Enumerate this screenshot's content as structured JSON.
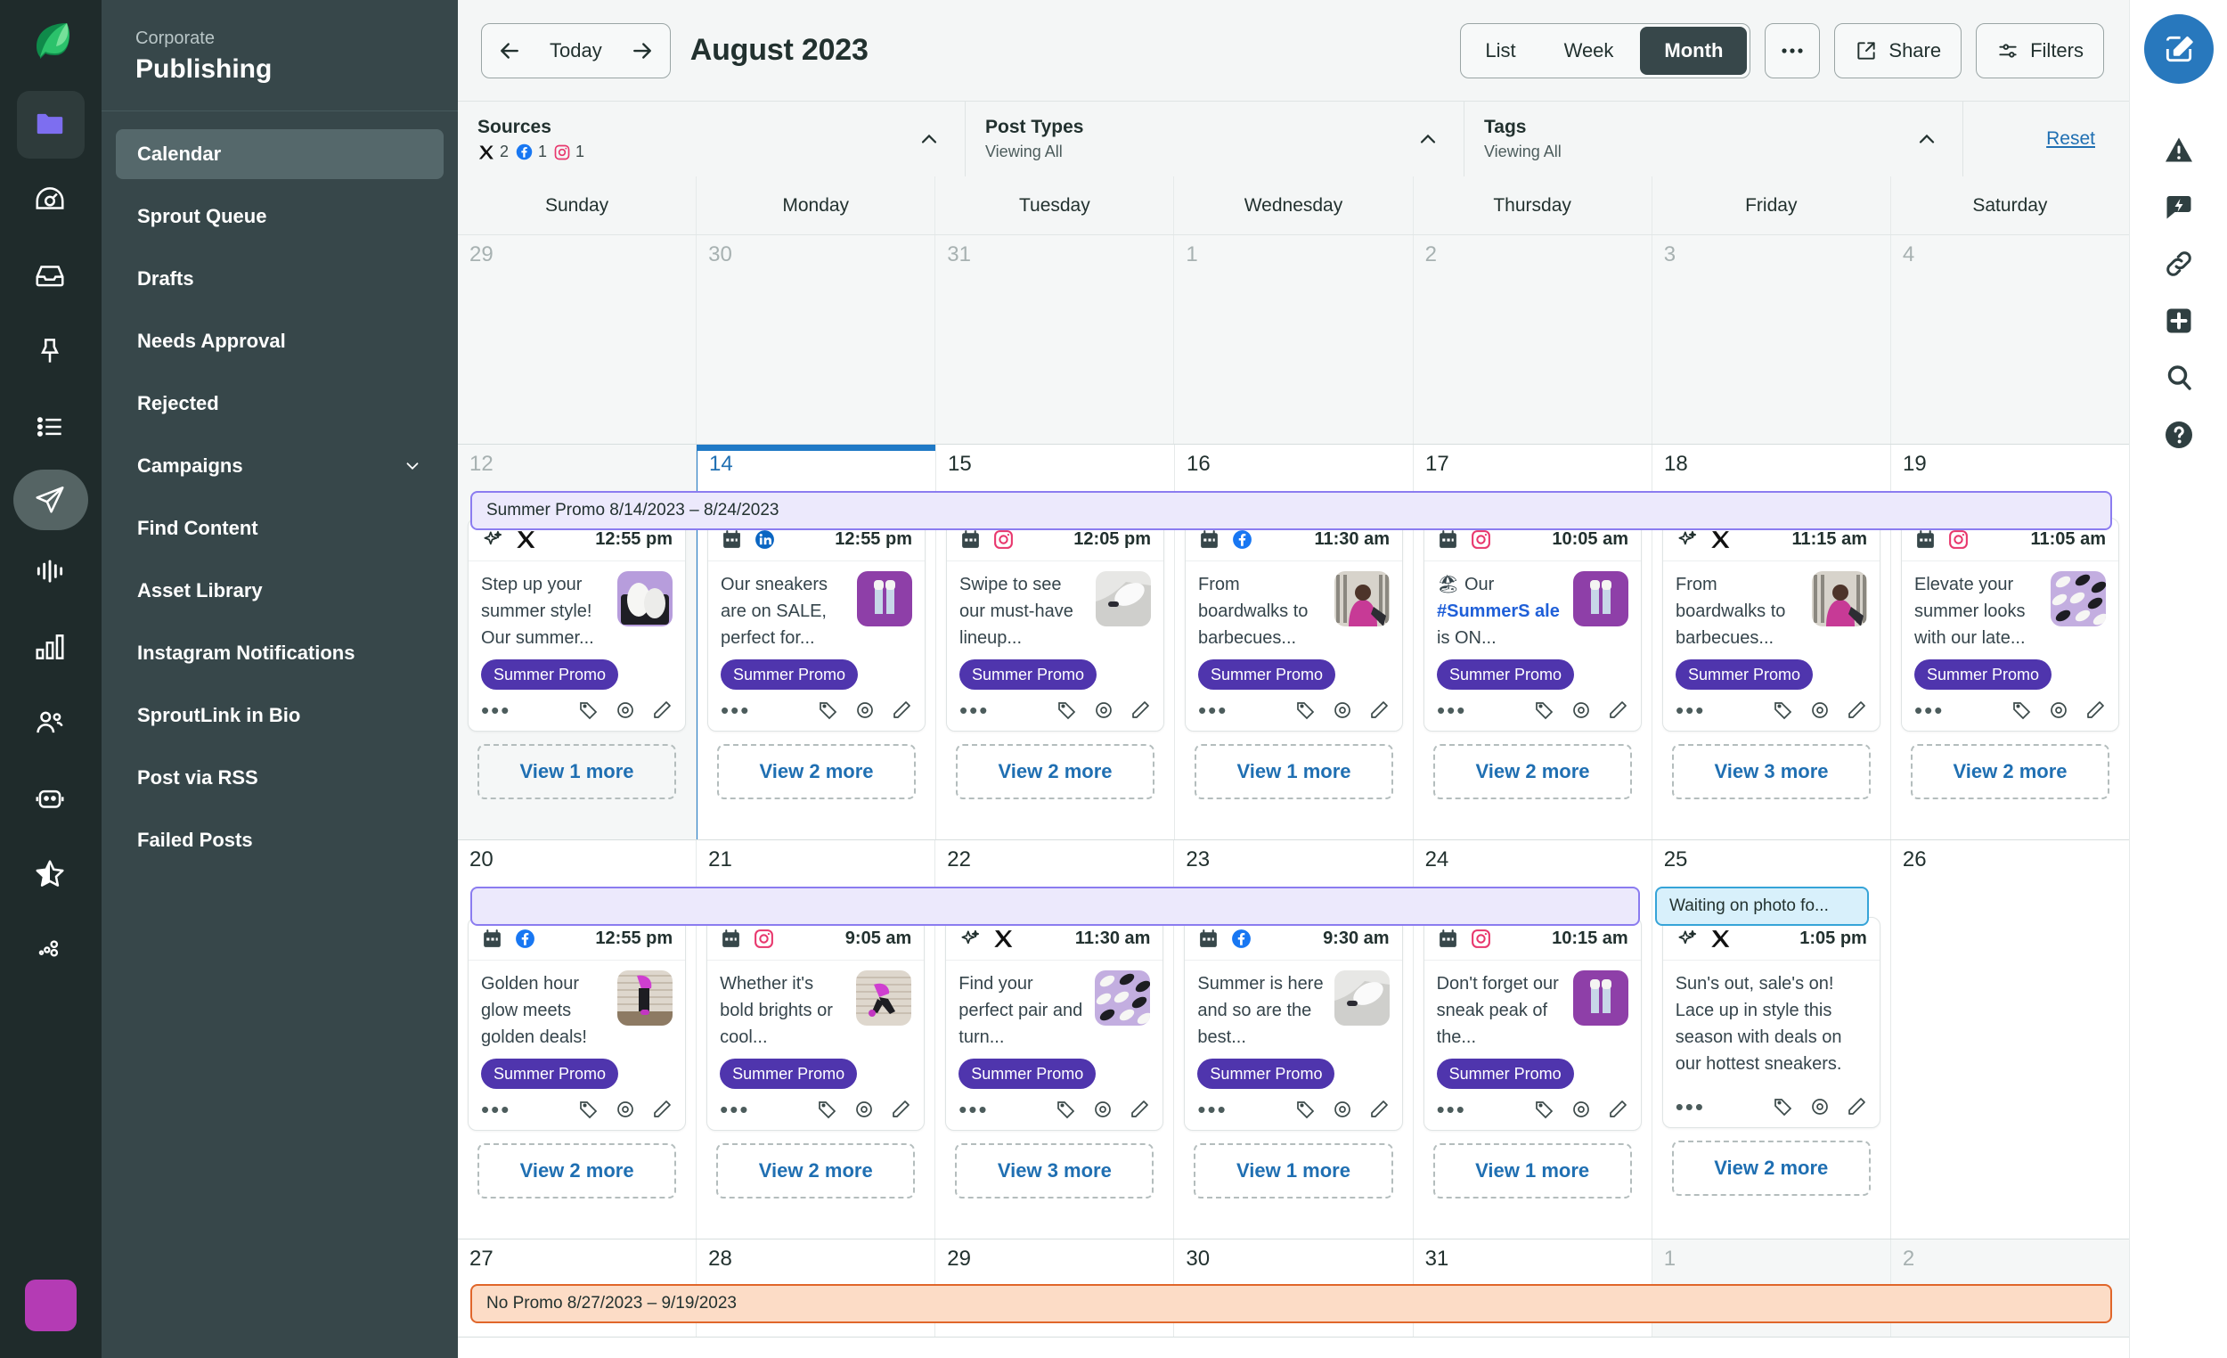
{
  "rail": {
    "logo": "sprout-leaf-logo",
    "items": [
      {
        "name": "folder-icon",
        "active": false,
        "boxed": true
      },
      {
        "name": "dashboard-gauge-icon",
        "active": false,
        "boxed": false
      },
      {
        "name": "inbox-icon",
        "active": false,
        "boxed": false
      },
      {
        "name": "pin-icon",
        "active": false,
        "boxed": false
      },
      {
        "name": "list-icon",
        "active": false,
        "boxed": false
      },
      {
        "name": "publishing-send-icon",
        "active": true,
        "boxed": false
      },
      {
        "name": "audio-levels-icon",
        "active": false,
        "boxed": false
      },
      {
        "name": "reports-bars-icon",
        "active": false,
        "boxed": false
      },
      {
        "name": "people-icon",
        "active": false,
        "boxed": false
      },
      {
        "name": "bot-icon",
        "active": false,
        "boxed": false
      },
      {
        "name": "star-icon",
        "active": false,
        "boxed": false
      },
      {
        "name": "scatter-dots-icon",
        "active": false,
        "boxed": false
      }
    ]
  },
  "nav": {
    "eyebrow": "Corporate",
    "title": "Publishing",
    "items": [
      {
        "label": "Calendar",
        "active": true,
        "chevron": false
      },
      {
        "label": "Sprout Queue",
        "active": false,
        "chevron": false
      },
      {
        "label": "Drafts",
        "active": false,
        "chevron": false
      },
      {
        "label": "Needs Approval",
        "active": false,
        "chevron": false
      },
      {
        "label": "Rejected",
        "active": false,
        "chevron": false
      },
      {
        "label": "Campaigns",
        "active": false,
        "chevron": true
      },
      {
        "label": "Find Content",
        "active": false,
        "chevron": false
      },
      {
        "label": "Asset Library",
        "active": false,
        "chevron": false
      },
      {
        "label": "Instagram Notifications",
        "active": false,
        "chevron": false
      },
      {
        "label": "SproutLink in Bio",
        "active": false,
        "chevron": false
      },
      {
        "label": "Post via RSS",
        "active": false,
        "chevron": false
      },
      {
        "label": "Failed Posts",
        "active": false,
        "chevron": false
      }
    ]
  },
  "toolbar": {
    "today_label": "Today",
    "month_title": "August 2023",
    "views": [
      {
        "label": "List",
        "selected": false
      },
      {
        "label": "Week",
        "selected": false
      },
      {
        "label": "Month",
        "selected": true
      }
    ],
    "more_label": "•••",
    "share_label": "Share",
    "filters_label": "Filters"
  },
  "filterbar": {
    "sources": {
      "title": "Sources",
      "counts": [
        {
          "network": "x-twitter",
          "count": "2"
        },
        {
          "network": "facebook",
          "count": "1"
        },
        {
          "network": "instagram",
          "count": "1"
        }
      ]
    },
    "post_types": {
      "title": "Post Types",
      "sub": "Viewing All"
    },
    "tags": {
      "title": "Tags",
      "sub": "Viewing All"
    },
    "reset_label": "Reset"
  },
  "calendar": {
    "day_names": [
      "Sunday",
      "Monday",
      "Tuesday",
      "Wednesday",
      "Thursday",
      "Friday",
      "Saturday"
    ],
    "colors": {
      "today": "#1f79c6",
      "campaign_purple_bg": "#ece9fc",
      "campaign_purple_border": "#8b7cf0",
      "campaign_orange_bg": "#fcdcc6",
      "campaign_orange_border": "#e0662a",
      "note_blue_bg": "#d8f0fb",
      "note_blue_border": "#36a4d8",
      "tag_chip": "#4f35ad"
    },
    "weeks": [
      {
        "days": [
          {
            "num": "29",
            "other": true,
            "today": false
          },
          {
            "num": "30",
            "other": true,
            "today": false
          },
          {
            "num": "31",
            "other": true,
            "today": false
          },
          {
            "num": "1",
            "other": true,
            "today": false
          },
          {
            "num": "2",
            "other": true,
            "today": false
          },
          {
            "num": "3",
            "other": true,
            "today": false
          },
          {
            "num": "4",
            "other": true,
            "today": false
          }
        ]
      },
      {
        "days": [
          {
            "num": "12",
            "other": true,
            "today": false
          },
          {
            "num": "14",
            "other": false,
            "today": true
          },
          {
            "num": "15",
            "other": false,
            "today": false
          },
          {
            "num": "16",
            "other": false,
            "today": false
          },
          {
            "num": "17",
            "other": false,
            "today": false
          },
          {
            "num": "18",
            "other": false,
            "today": false
          },
          {
            "num": "19",
            "other": false,
            "today": false
          }
        ]
      },
      {
        "days": [
          {
            "num": "20",
            "other": false,
            "today": false
          },
          {
            "num": "21",
            "other": false,
            "today": false
          },
          {
            "num": "22",
            "other": false,
            "today": false
          },
          {
            "num": "23",
            "other": false,
            "today": false
          },
          {
            "num": "24",
            "other": false,
            "today": false
          },
          {
            "num": "25",
            "other": false,
            "today": false
          },
          {
            "num": "26",
            "other": false,
            "today": false
          }
        ]
      },
      {
        "days": [
          {
            "num": "27",
            "other": false,
            "today": false
          },
          {
            "num": "28",
            "other": false,
            "today": false
          },
          {
            "num": "29",
            "other": false,
            "today": false
          },
          {
            "num": "30",
            "other": false,
            "today": false
          },
          {
            "num": "31",
            "other": false,
            "today": false
          },
          {
            "num": "1",
            "other": true,
            "today": false
          },
          {
            "num": "2",
            "other": true,
            "today": false
          }
        ]
      }
    ],
    "campaigns": {
      "summer_promo_w2": "Summer Promo  8/14/2023 – 8/24/2023",
      "summer_promo_w3": "",
      "waiting_note": "Waiting on photo fo...",
      "no_promo_w4": "No Promo 8/27/2023 – 9/19/2023"
    },
    "week2_posts": [
      {
        "day": "Sunday",
        "ai": true,
        "network": "x-twitter",
        "time": "12:55 pm",
        "text": "Step up your summer style! Our summer...",
        "tag": "Summer Promo",
        "thumb": "sneakers-white-purple",
        "view_more": "View 1 more"
      },
      {
        "day": "Monday",
        "ai": false,
        "network": "linkedin",
        "time": "12:55 pm",
        "text": "Our sneakers are on SALE, perfect for...",
        "tag": "Summer Promo",
        "thumb": "legs-up-purple",
        "view_more": "View 2 more"
      },
      {
        "day": "Tuesday",
        "ai": false,
        "network": "instagram",
        "time": "12:05 pm",
        "text": "Swipe to see our must-have lineup...",
        "tag": "Summer Promo",
        "thumb": "foot-sneaker-white",
        "view_more": "View 2 more"
      },
      {
        "day": "Wednesday",
        "ai": false,
        "network": "facebook",
        "time": "11:30 am",
        "text": "From boardwalks to barbecues...",
        "tag": "Summer Promo",
        "thumb": "person-pink-jacket",
        "view_more": "View 1 more"
      },
      {
        "day": "Thursday",
        "ai": false,
        "network": "instagram",
        "time": "10:05 am",
        "text_pre": "🏖 Our ",
        "hashtag": "#SummerS ale",
        "text_post": " is ON...",
        "text": "🏖 Our #SummerSale is ON...",
        "tag": "Summer Promo",
        "thumb": "legs-up-purple",
        "view_more": "View 2 more"
      },
      {
        "day": "Friday",
        "ai": true,
        "network": "x-twitter",
        "time": "11:15 am",
        "text": "From boardwalks to barbecues...",
        "tag": "Summer Promo",
        "thumb": "person-pink-jacket",
        "view_more": "View 3 more"
      },
      {
        "day": "Saturday",
        "ai": false,
        "network": "instagram",
        "time": "11:05 am",
        "text": "Elevate your summer looks with our late...",
        "tag": "Summer Promo",
        "thumb": "sneakers-grid-lilac",
        "view_more": "View 2 more"
      }
    ],
    "week3_posts": [
      {
        "day": "Sunday",
        "ai": false,
        "network": "facebook",
        "time": "12:55 pm",
        "text": "Golden hour glow meets golden deals!",
        "tag": "Summer Promo",
        "thumb": "runner-magenta-wall",
        "view_more": "View 2 more"
      },
      {
        "day": "Monday",
        "ai": false,
        "network": "instagram",
        "time": "9:05 am",
        "text": "Whether it's bold brights or cool...",
        "tag": "Summer Promo",
        "thumb": "jumper-magenta",
        "view_more": "View 2 more"
      },
      {
        "day": "Tuesday",
        "ai": true,
        "network": "x-twitter",
        "time": "11:30 am",
        "text": "Find your perfect pair and turn...",
        "tag": "Summer Promo",
        "thumb": "sneakers-grid-lilac",
        "view_more": "View 3 more"
      },
      {
        "day": "Wednesday",
        "ai": false,
        "network": "facebook",
        "time": "9:30 am",
        "text": "Summer is here and so are the best...",
        "tag": "Summer Promo",
        "thumb": "foot-sneaker-white",
        "view_more": "View 1 more"
      },
      {
        "day": "Thursday",
        "ai": false,
        "network": "instagram",
        "time": "10:15 am",
        "text": "Don't forget our sneak peak of the...",
        "tag": "Summer Promo",
        "thumb": "legs-up-purple",
        "view_more": "View 1 more"
      },
      {
        "day": "Friday",
        "ai": true,
        "network": "x-twitter",
        "time": "1:05 pm",
        "text": "Sun's out, sale's on! Lace up in style this season with deals on our hottest sneakers.",
        "tag": "",
        "thumb": "",
        "view_more": "View 2 more"
      },
      {
        "day": "Saturday",
        "ai": false,
        "network": "",
        "time": "",
        "text": "",
        "tag": "",
        "thumb": "",
        "view_more": ""
      }
    ]
  },
  "right_rail": {
    "items": [
      {
        "name": "compose-pencil-icon",
        "primary": true
      },
      {
        "name": "alert-warning-icon",
        "primary": false
      },
      {
        "name": "chat-bolt-icon",
        "primary": false
      },
      {
        "name": "link-chain-icon",
        "primary": false
      },
      {
        "name": "plus-square-icon",
        "primary": false
      },
      {
        "name": "search-icon",
        "primary": false
      },
      {
        "name": "help-question-icon",
        "primary": false
      }
    ]
  }
}
